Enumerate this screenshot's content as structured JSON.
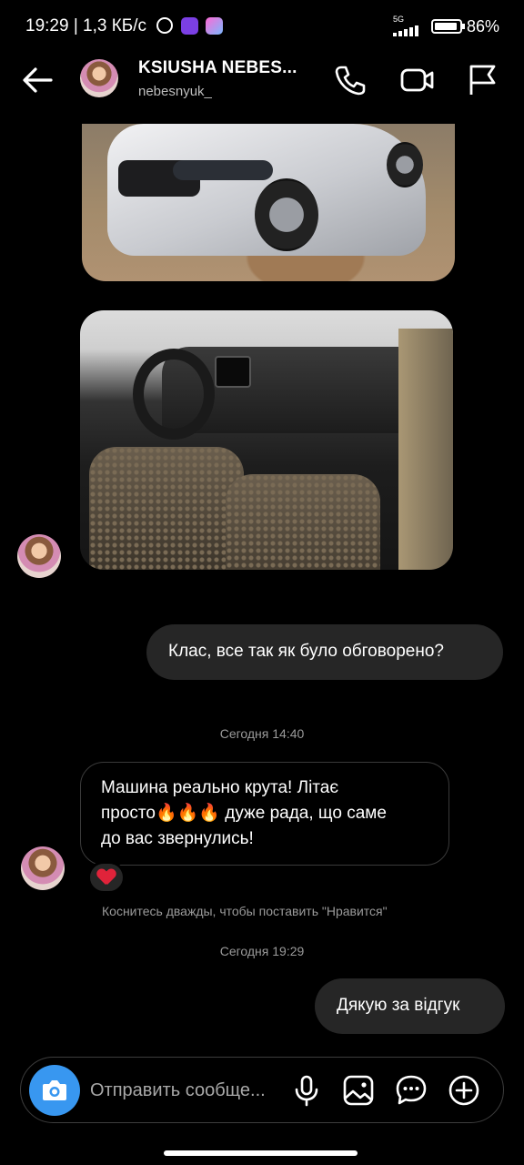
{
  "status_bar": {
    "time": "19:29",
    "speed": "1,3 КБ/с",
    "network": "5G",
    "battery": "86%"
  },
  "header": {
    "name": "KSIUSHA NEBES...",
    "handle": "nebesnyuk_"
  },
  "messages": [
    {
      "type": "image",
      "sender": "them",
      "description": "car-exterior"
    },
    {
      "type": "image",
      "sender": "them",
      "description": "car-interior"
    },
    {
      "type": "text",
      "sender": "me",
      "text": "Клас, все так як було обговорено?"
    },
    {
      "type": "timestamp",
      "text": "Сегодня 14:40"
    },
    {
      "type": "text",
      "sender": "them",
      "text_line1": "Машина реально крута! Літає",
      "text_line2": "просто🔥🔥🔥 дуже рада, що саме",
      "text_line3": "до вас звернулись!",
      "reaction": "❤"
    },
    {
      "type": "hint",
      "text": "Коснитесь дважды, чтобы поставить \"Нравится\""
    },
    {
      "type": "timestamp",
      "text": "Сегодня 19:29"
    },
    {
      "type": "text",
      "sender": "me",
      "text": "Дякую за відгук"
    }
  ],
  "composer": {
    "placeholder": "Отправить сообще..."
  },
  "colors": {
    "background": "#000000",
    "outgoing_bubble": "#262626",
    "camera_button": "#3897f0",
    "reaction_heart": "#e0233a",
    "muted_text": "#9a9a9a"
  },
  "icons": [
    "back-arrow-icon",
    "phone-icon",
    "video-camera-icon",
    "flag-icon",
    "camera-icon",
    "microphone-icon",
    "gallery-icon",
    "sticker-icon",
    "plus-icon",
    "alarm-icon"
  ]
}
